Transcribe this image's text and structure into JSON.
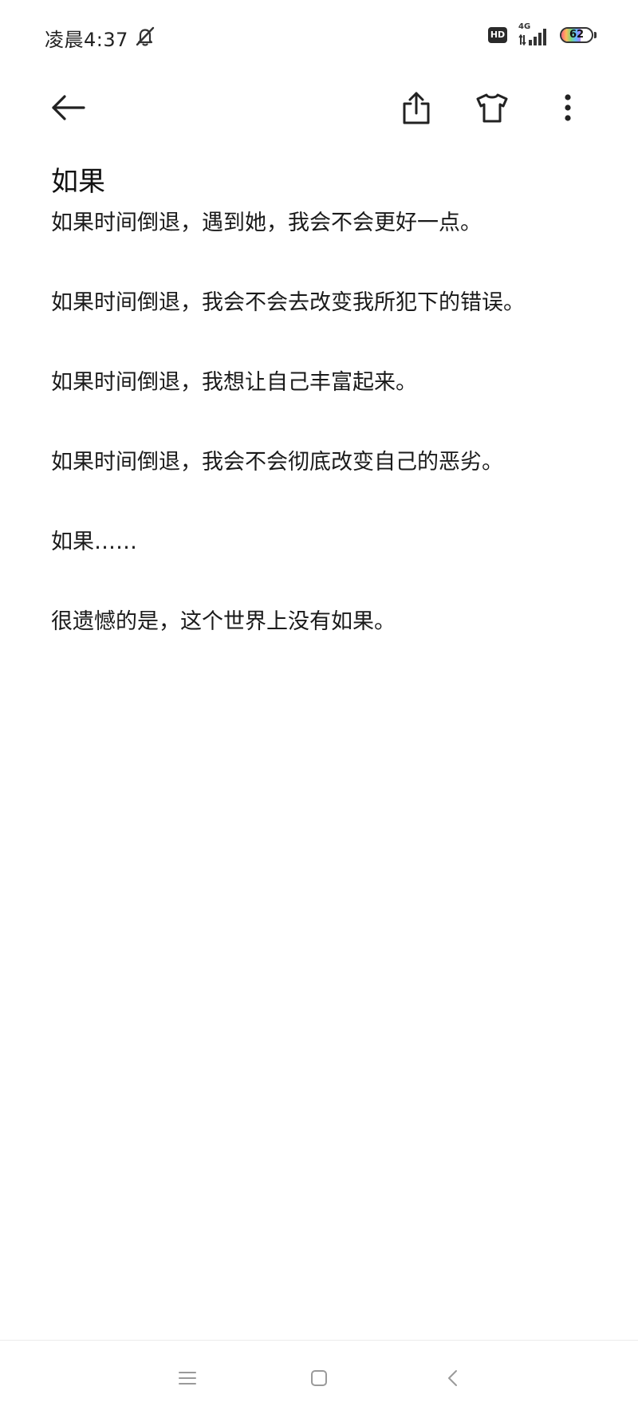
{
  "status_bar": {
    "time": "凌晨4:37",
    "hd_label": "HD",
    "network_label": "4G",
    "battery_level": "62",
    "battery_fraction": 0.62
  },
  "toolbar": {
    "back_icon": "arrow-left-icon",
    "share_icon": "share-icon",
    "theme_icon": "tshirt-icon",
    "more_icon": "more-vertical-icon"
  },
  "note": {
    "title": "如果",
    "lines": [
      "如果时间倒退，遇到她，我会不会更好一点。",
      "如果时间倒退，我会不会去改变我所犯下的错误。",
      "如果时间倒退，我想让自己丰富起来。",
      "如果时间倒退，我会不会彻底改变自己的恶劣。",
      "如果……",
      "很遗憾的是，这个世界上没有如果。"
    ]
  },
  "nav": {
    "menu_icon": "menu-icon",
    "home_icon": "square-home-icon",
    "back_icon": "chevron-left-icon"
  }
}
